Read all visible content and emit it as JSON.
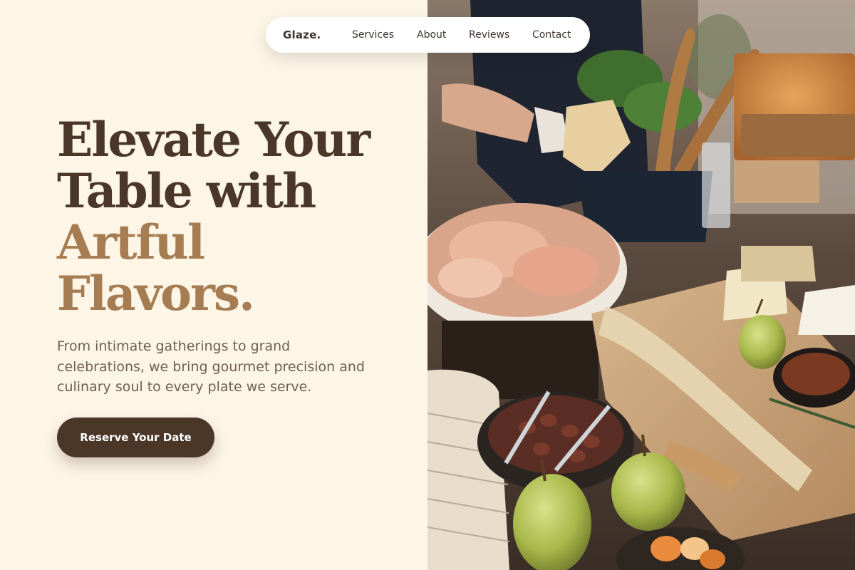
{
  "brand": {
    "logo": "Glaze."
  },
  "nav": {
    "items": [
      {
        "label": "Services"
      },
      {
        "label": "About"
      },
      {
        "label": "Reviews"
      },
      {
        "label": "Contact"
      }
    ]
  },
  "hero": {
    "headline_line1": "Elevate Your",
    "headline_line2": "Table with",
    "headline_accent1": "Artful",
    "headline_accent2": "Flavors.",
    "subtext": "From intimate gatherings to grand celebrations, we bring gourmet precision and culinary soul to every plate we serve.",
    "cta_label": "Reserve Your Date"
  },
  "colors": {
    "background": "#fdf5e6",
    "primary_dark": "#4a3728",
    "accent": "#a67c52",
    "body_text": "#6e5f55",
    "nav_bg": "#ffffff"
  },
  "image": {
    "semantic": "catering-grazing-table-photo"
  }
}
